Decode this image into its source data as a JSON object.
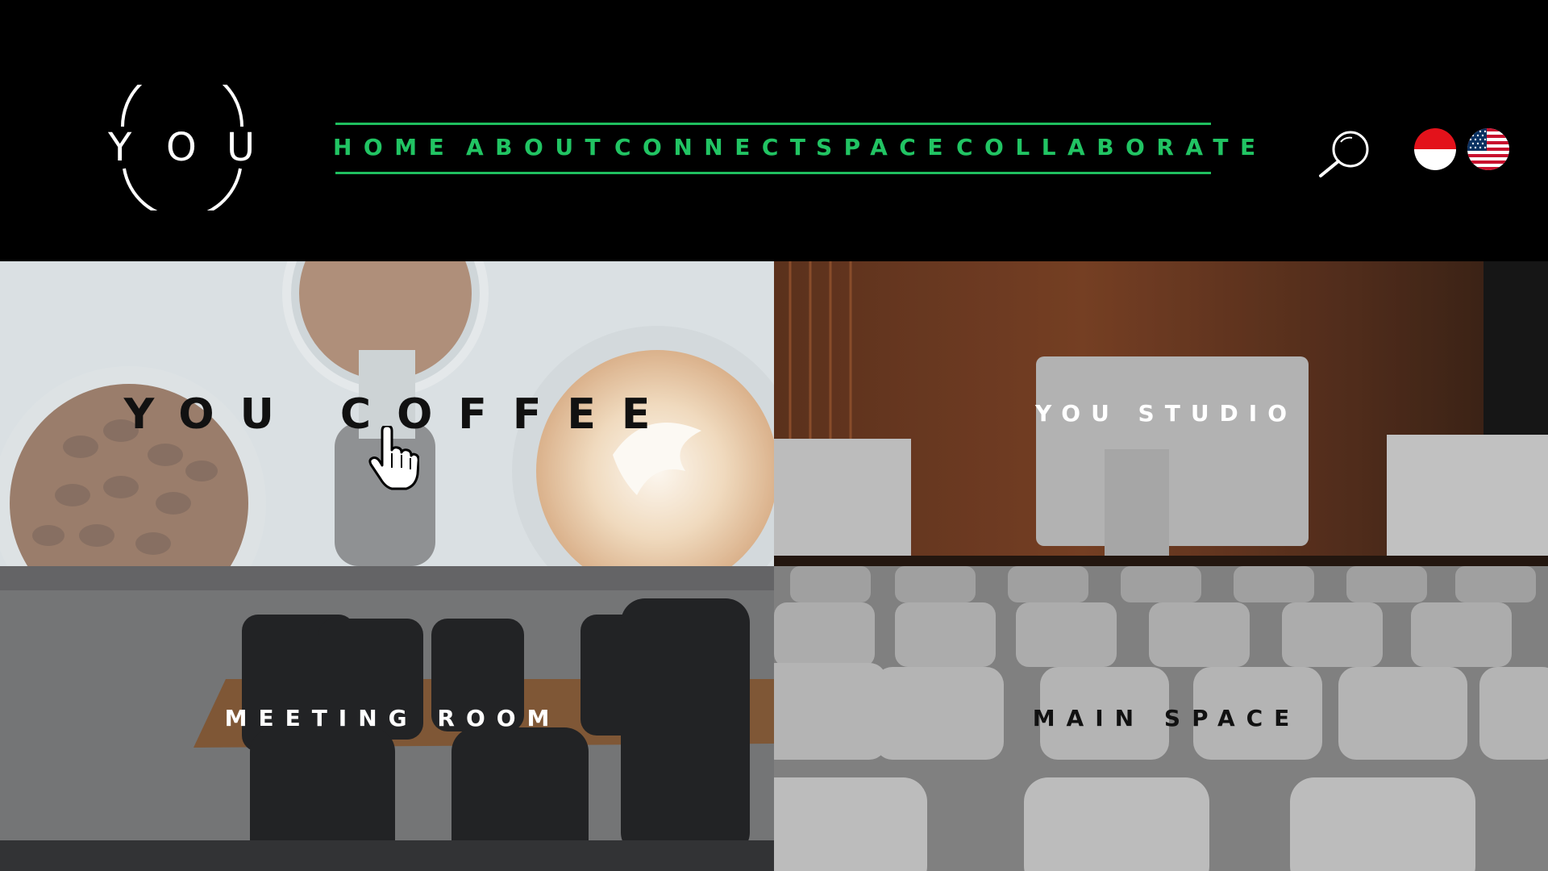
{
  "header": {
    "logo": {
      "letters": [
        "Y",
        "O",
        "U"
      ]
    },
    "nav": [
      {
        "label": "HOME"
      },
      {
        "label": "ABOUT"
      },
      {
        "label": "CONNECT"
      },
      {
        "label": "SPACE"
      },
      {
        "label": "COLLABORATE"
      }
    ],
    "icons": {
      "search": "search-icon",
      "flag_id": "indonesia-flag-icon",
      "flag_us": "usa-flag-icon"
    },
    "colors": {
      "accent": "#21c463",
      "background": "#000000"
    }
  },
  "tiles": [
    {
      "label": "YOU COFFEE"
    },
    {
      "label": "YOU STUDIO"
    },
    {
      "label": "MEETING ROOM"
    },
    {
      "label": "MAIN SPACE"
    }
  ]
}
